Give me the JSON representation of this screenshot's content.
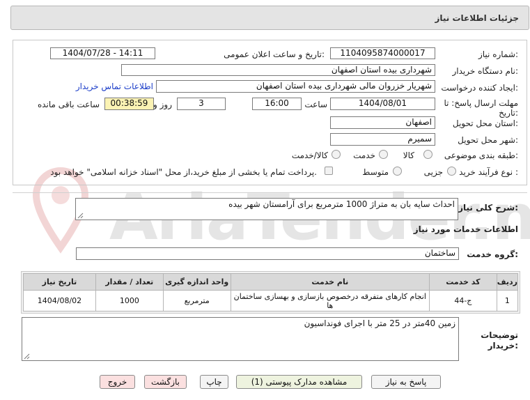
{
  "header": {
    "title": "جزئیات اطلاعات نیاز"
  },
  "form": {
    "need_number_label": "شماره نیاز:",
    "need_number": "1104095874000017",
    "announce_label": "تاریخ و ساعت اعلان عمومی:",
    "announce_value": "1404/07/28 - 14:11",
    "buyer_org_label": "نام دستگاه خریدار:",
    "buyer_org": "شهرداری بیده استان اصفهان",
    "creator_label": "ایجاد کننده درخواست:",
    "creator": "شهریار خزروان مالی  شهرداری بیده استان اصفهان",
    "contact_link": "اطلاعات تماس خریدار",
    "deadline_label_1": "مهلت ارسال پاسخ: تا",
    "deadline_label_2": "تاریخ:",
    "deadline_date": "1404/08/01",
    "time_label": "ساعت",
    "deadline_time": "16:00",
    "days_value": "3",
    "days_label": "روز و",
    "remaining_time": "00:38:59",
    "remaining_label": "ساعت باقی مانده",
    "province_label": "استان محل تحویل:",
    "province": "اصفهان",
    "city_label": "شهر محل تحویل:",
    "city": "سمیرم",
    "category_label": "طبقه بندی موضوعی:",
    "category_options": [
      "کالا",
      "خدمت",
      "کالا/خدمت"
    ],
    "process_label": "نوع فرآیند خرید :",
    "process_options": [
      "جزیی",
      "متوسط"
    ],
    "payment_note": "پرداخت تمام یا بخشی از مبلغ خرید،از محل \"اسناد خزانه اسلامی\" خواهد بود."
  },
  "description": {
    "label": "شرح کلی نیاز:",
    "value": "احداث سایه بان به متراژ 1000 مترمربع برای آرامستان شهر بیده"
  },
  "services": {
    "section_title": "اطلاعات خدمات مورد نیاز",
    "group_label": "گروه خدمت:",
    "group_value": "ساختمان",
    "table": {
      "headers": [
        "ردیف",
        "کد خدمت",
        "نام خدمت",
        "واحد اندازه گیری",
        "تعداد / مقدار",
        "تاریخ نیاز"
      ],
      "rows": [
        [
          "1",
          "ج-44",
          "انجام کارهای متفرقه درخصوص بازسازی و بهسازی ساختمان ها",
          "مترمربع",
          "1000",
          "1404/08/02"
        ]
      ]
    }
  },
  "buyer_notes": {
    "label_1": "توضیحات",
    "label_2": "خریدار:",
    "value": "زمین 40متر در 25 متر با اجرای فونداسیون"
  },
  "buttons": {
    "reply": "پاسخ به نیاز",
    "docs": "مشاهده مدارک پیوستی (1)",
    "print": "چاپ",
    "back": "بازگشت",
    "exit": "خروج"
  },
  "watermark": {
    "text": "AriaTender.neT"
  },
  "colors": {
    "link": "#1a3cc8",
    "remaining_bg": "#fbf3b4",
    "watermark": "#d9534f"
  }
}
